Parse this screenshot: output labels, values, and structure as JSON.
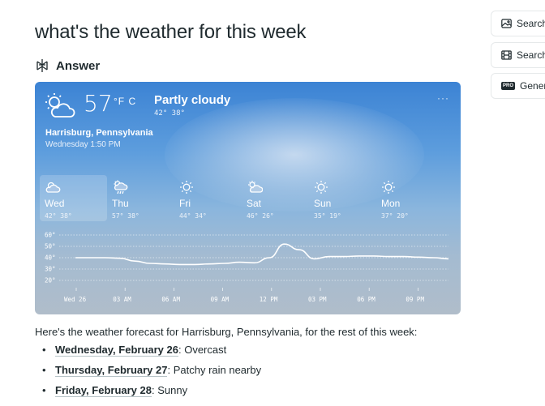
{
  "query": "what's the weather for this week",
  "answer_label": "Answer",
  "weather": {
    "current": {
      "icon": "partly-cloudy-sun-icon",
      "temp": "57",
      "units": "°F C",
      "condition": "Partly cloudy",
      "hilo": "42° 38°"
    },
    "menu": "···",
    "location": "Harrisburg, Pennsylvania",
    "datetime": "Wednesday 1:50 PM",
    "days": [
      {
        "name": "Wed",
        "hilo": "42° 38°",
        "icon": "cloud-icon"
      },
      {
        "name": "Thu",
        "hilo": "57° 38°",
        "icon": "rain-cloud-icon"
      },
      {
        "name": "Fri",
        "hilo": "44° 34°",
        "icon": "sun-icon"
      },
      {
        "name": "Sat",
        "hilo": "46° 26°",
        "icon": "partly-cloudy-sun-icon"
      },
      {
        "name": "Sun",
        "hilo": "35° 19°",
        "icon": "sun-icon"
      },
      {
        "name": "Mon",
        "hilo": "37° 20°",
        "icon": "sun-icon"
      }
    ]
  },
  "chart_data": {
    "type": "line",
    "y_ticks": [
      "60°",
      "50°",
      "40°",
      "30°",
      "20°"
    ],
    "ylim": [
      20,
      60
    ],
    "x_ticks": [
      "Wed 26",
      "03 AM",
      "06 AM",
      "09 AM",
      "12 PM",
      "03 PM",
      "06 PM",
      "09 PM"
    ],
    "series": [
      {
        "values": [
          40,
          40,
          40,
          39.5,
          37,
          35,
          34.5,
          34,
          34,
          34.5,
          35,
          36,
          35.5,
          40,
          52,
          47,
          39,
          41,
          41,
          41.5,
          41.5,
          41,
          41,
          40.5,
          40,
          39
        ]
      }
    ]
  },
  "summary": "Here's the weather forecast for Harrisburg, Pennsylvania, for the rest of this week:",
  "forecast": [
    {
      "day": "Wednesday, February 26",
      "rest": ": Overcast"
    },
    {
      "day": "Thursday, February 27",
      "rest": ": Patchy rain nearby"
    },
    {
      "day": "Friday, February 28",
      "rest": ": Sunny"
    }
  ],
  "side_buttons": [
    {
      "label": "Search",
      "icon": "image-icon"
    },
    {
      "label": "Search",
      "icon": "film-icon"
    },
    {
      "label": "Genera",
      "icon": "pro-badge-icon",
      "badge": "PRO"
    }
  ]
}
